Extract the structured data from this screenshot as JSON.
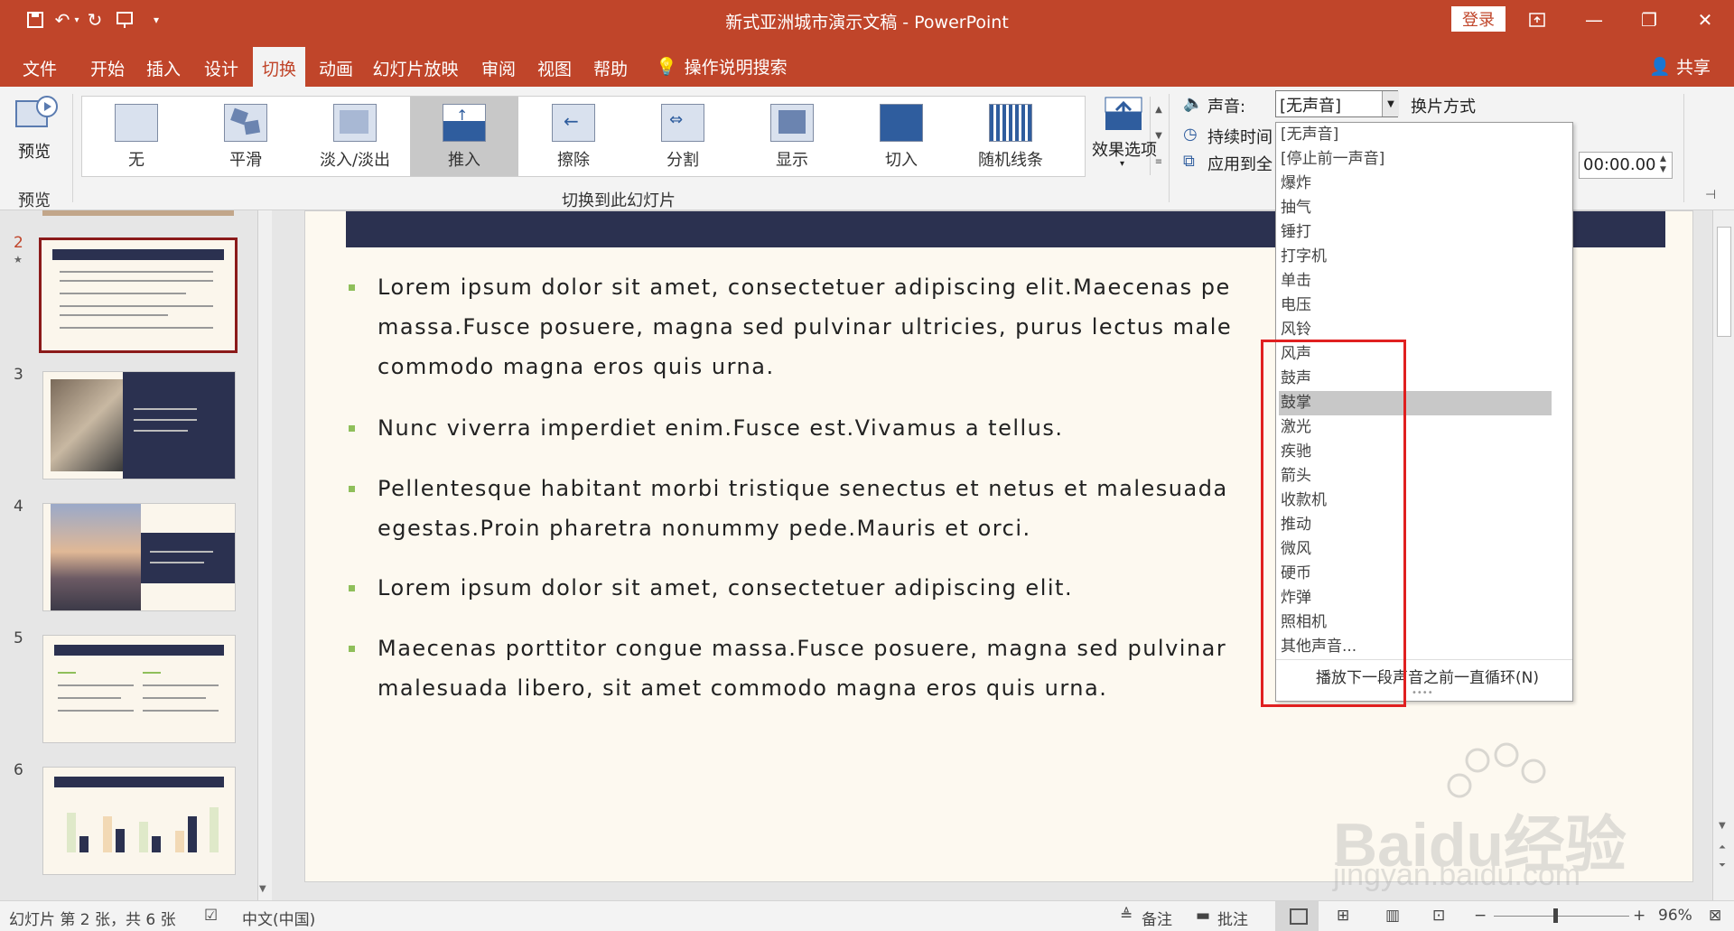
{
  "window": {
    "title": "新式亚洲城市演示文稿 - PowerPoint",
    "login_label": "登录",
    "share_label": "共享",
    "search_tip": "操作说明搜索"
  },
  "tabs": [
    {
      "label": "文件"
    },
    {
      "label": "开始"
    },
    {
      "label": "插入"
    },
    {
      "label": "设计"
    },
    {
      "label": "切换"
    },
    {
      "label": "动画"
    },
    {
      "label": "幻灯片放映"
    },
    {
      "label": "审阅"
    },
    {
      "label": "视图"
    },
    {
      "label": "帮助"
    }
  ],
  "ribbon": {
    "preview_label": "预览",
    "preview_group": "预览",
    "transitions_group": "切换到此幻灯片",
    "effects": [
      "无",
      "平滑",
      "淡入/淡出",
      "推入",
      "擦除",
      "分割",
      "显示",
      "切入",
      "随机线条"
    ],
    "selected_effect": "推入",
    "effect_options": "效果选项",
    "sound_label": "声音:",
    "sound_value": "[无声音]",
    "duration_label": "持续时间",
    "apply_all_label": "应用到全",
    "advance_label": "换片方式",
    "time_value": "00:00.00"
  },
  "sound_dropdown": {
    "items": [
      "[无声音]",
      "[停止前一声音]",
      "爆炸",
      "抽气",
      "锤打",
      "打字机",
      "单击",
      "电压",
      "风铃",
      "风声",
      "鼓声",
      "鼓掌",
      "激光",
      "疾驰",
      "箭头",
      "收款机",
      "推动",
      "微风",
      "硬币",
      "炸弹",
      "照相机",
      "其他声音..."
    ],
    "highlighted": "鼓掌",
    "loop_label": "播放下一段声音之前一直循环(N)"
  },
  "slides_panel": {
    "numbers": [
      "2",
      "3",
      "4",
      "5",
      "6"
    ],
    "current": "2",
    "star": "★"
  },
  "slide": {
    "bullets": [
      "Lorem ipsum dolor sit amet, consectetuer adipiscing elit.Maecenas pe",
      "massa.Fusce posuere, magna sed pulvinar ultricies, purus lectus male",
      "commodo magna eros quis urna.",
      "Nunc viverra imperdiet enim.Fusce est.Vivamus a tellus.",
      "Pellentesque habitant morbi tristique senectus et netus et malesuada",
      "egestas.Proin pharetra nonummy pede.Mauris et orci.",
      "Lorem ipsum dolor sit amet, consectetuer adipiscing elit.",
      "Maecenas porttitor congue massa.Fusce posuere, magna sed pulvinar",
      "malesuada libero, sit amet commodo magna eros quis urna."
    ]
  },
  "status": {
    "slide_info": "幻灯片 第 2 张，共 6 张",
    "language": "中文(中国)",
    "notes": "备注",
    "comments": "批注",
    "zoom": "96%"
  },
  "watermark": {
    "brand": "Baidu经验",
    "url": "jingyan.baidu.com"
  },
  "colors": {
    "accent": "#c0452a",
    "slide_header": "#2b3150",
    "bullet": "#8fbf5a",
    "highlight_box": "#e02020"
  }
}
